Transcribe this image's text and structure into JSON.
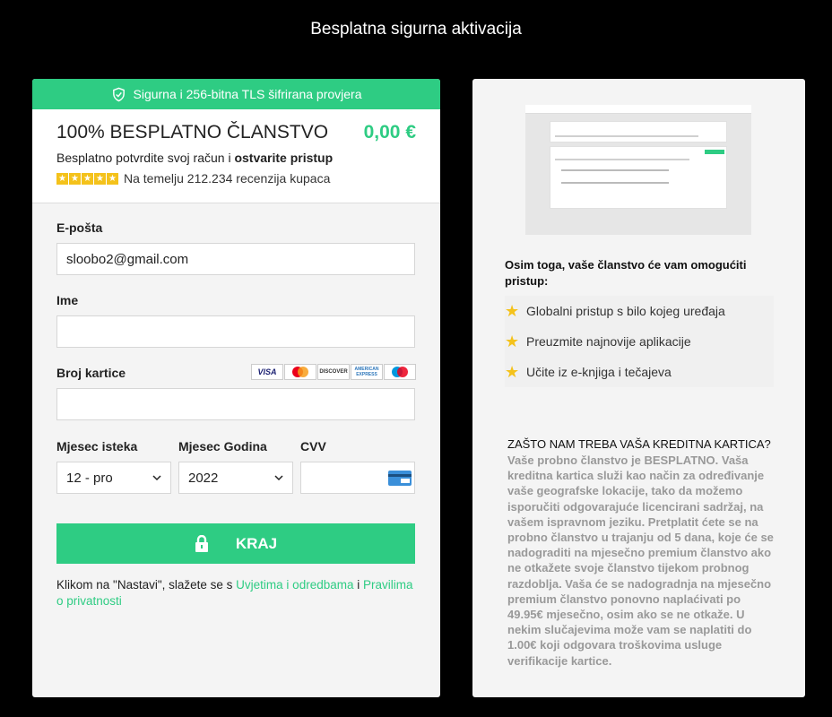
{
  "page": {
    "title": "Besplatna sigurna aktivacija"
  },
  "left": {
    "secure_banner": "Sigurna i 256-bitna TLS šifrirana provjera",
    "plan_name": "100% BESPLATNO ČLANSTVO",
    "plan_price": "0,00 €",
    "subtitle_prefix": "Besplatno potvrdite svoj račun i ",
    "subtitle_bold": "ostvarite pristup",
    "rating_text": "Na temelju 212.234 recenzija kupaca",
    "email_label": "E-pošta",
    "email_value": "sloobo2@gmail.com",
    "name_label": "Ime",
    "name_value": "",
    "card_label": "Broj kartice",
    "card_value": "",
    "card_brands": [
      "VISA",
      "mastercard",
      "DISCOVER",
      "AMERICAN EXPRESS",
      "maestro"
    ],
    "month_label": "Mjesec isteka",
    "month_value": "12 - pro",
    "year_label": "Mjesec Godina",
    "year_value": "2022",
    "cvv_label": "CVV",
    "cvv_value": "",
    "submit_label": "KRAJ",
    "terms_prefix": "Klikom na \"Nastavi\", slažete se s ",
    "terms_link1": "Uvjetima i odredbama",
    "terms_mid": " i ",
    "terms_link2": "Pravilima o privatnosti"
  },
  "right": {
    "benefits_title": "Osim toga, vaše članstvo će vam omogućiti pristup:",
    "benefits": [
      "Globalni pristup s bilo kojeg uređaja",
      "Preuzmite najnovije aplikacije",
      "Učite iz e-knjiga i tečajeva"
    ],
    "why_title": "ZAŠTO NAM TREBA VAŠA KREDITNA KARTICA?",
    "why_text": "Vaše probno članstvo je BESPLATNO. Vaša kreditna kartica služi kao način za određivanje vaše geografske lokacije, tako da možemo isporučiti odgovarajuće licencirani sadržaj, na vašem ispravnom jeziku. Pretplatit ćete se na probno članstvo u trajanju od 5 dana, koje će se nadograditi na mjesečno premium članstvo ako ne otkažete svoje članstvo tijekom probnog razdoblja. Vaša će se nadogradnja na mjesečno premium članstvo ponovno naplaćivati po 49.95€ mjesečno, osim ako se ne otkaže. U nekim slučajevima može vam se naplatiti do 1.00€ koji odgovara troškovima usluge verifikacije kartice."
  },
  "colors": {
    "accent": "#2ecc83",
    "star": "#f4c21b"
  }
}
